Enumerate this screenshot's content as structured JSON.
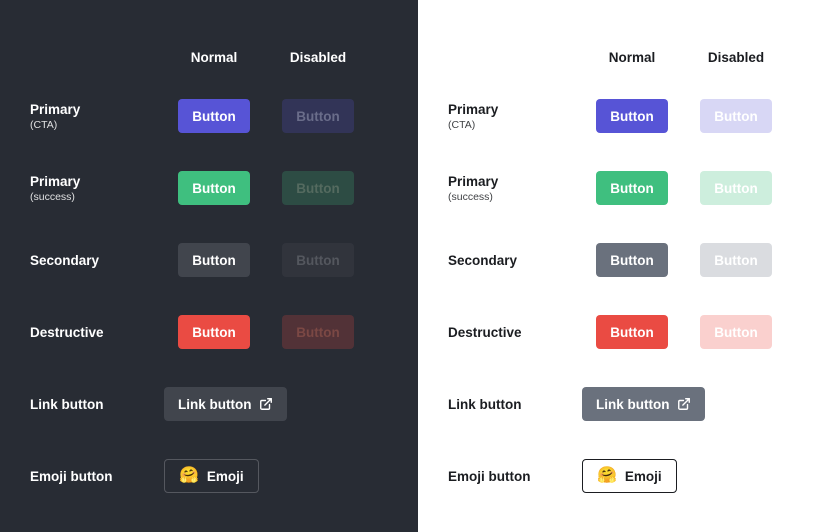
{
  "columns": {
    "normal": "Normal",
    "disabled": "Disabled"
  },
  "rows": {
    "primary_cta": {
      "label": "Primary",
      "sublabel": "(CTA)",
      "button_text": "Button"
    },
    "primary_success": {
      "label": "Primary",
      "sublabel": "(success)",
      "button_text": "Button"
    },
    "secondary": {
      "label": "Secondary",
      "button_text": "Button"
    },
    "destructive": {
      "label": "Destructive",
      "button_text": "Button"
    },
    "link": {
      "label": "Link button",
      "button_text": "Link button"
    },
    "emoji": {
      "label": "Emoji button",
      "button_text": "Emoji",
      "emoji": "🤗"
    }
  },
  "colors": {
    "cta": "#5754d6",
    "success": "#3fbf7f",
    "secondary_dark": "#41454d",
    "secondary_light": "#6a717d",
    "destructive": "#ea4b43",
    "link_dark": "#41454d",
    "link_light": "#6a717d",
    "emoji_dark_bg": "#282c34",
    "emoji_dark_border": "#55585f",
    "emoji_light_bg": "#ffffff",
    "emoji_light_border": "#1b1d21",
    "dark_disabled_text": "#5d6067",
    "light_disabled_text": "#ffffff"
  }
}
